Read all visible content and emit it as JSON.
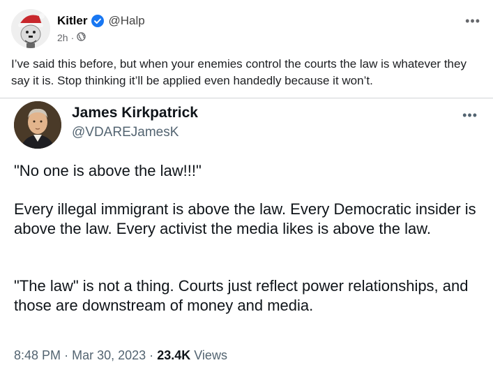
{
  "post": {
    "author_name": "Kitler",
    "handle": "@Halp",
    "time": "2h",
    "separator": "·",
    "audience_icon": "globe-icon",
    "more_icon": "more-horizontal-icon",
    "text": "I’ve said this before, but when your enemies control the courts the law is whatever they say it is. Stop thinking it’ll be applied even handedly because it won’t."
  },
  "embed": {
    "author_name": "James Kirkpatrick",
    "handle": "@VDAREJamesK",
    "more_icon": "more-horizontal-icon",
    "paragraphs": [
      "\"No one is above the law!!!\"",
      "Every illegal immigrant is above the law. Every Democratic insider is above the law. Every activist the media likes is above the law.",
      "\"The law\" is not a thing. Courts just reflect power relationships, and those are downstream of money and media."
    ],
    "time": "8:48 PM",
    "date": "Mar 30, 2023",
    "separator": "·",
    "views_count": "23.4K",
    "views_label": "Views"
  },
  "colors": {
    "verified_blue": "#1877f2",
    "meta_gray": "#65676b",
    "tweet_gray": "#536471"
  }
}
